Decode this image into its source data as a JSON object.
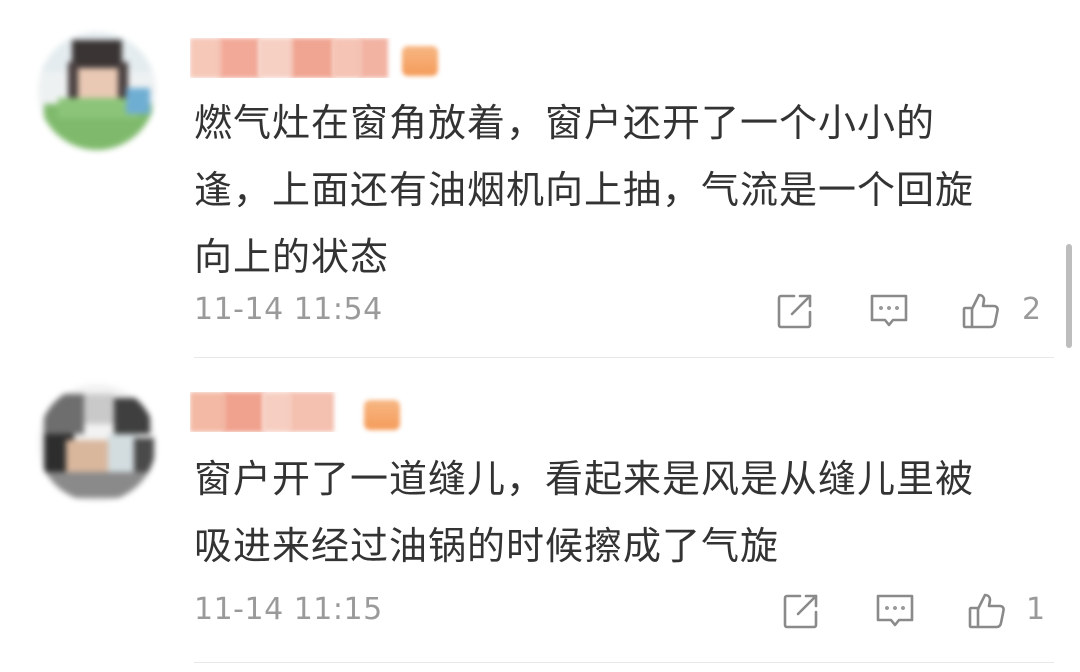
{
  "comments": [
    {
      "username": "",
      "text_lines": [
        "燃气灶在窗角放着，窗户还开了一个小小的",
        "逢，上面还有油烟机向上抽，气流是一个回旋",
        "向上的状态"
      ],
      "time": "11-14 11:54",
      "likes": "2"
    },
    {
      "username": "",
      "text_lines": [
        "窗户开了一道缝儿，看起来是风是从缝儿里被",
        "吸进来经过油锅的时候擦成了气旋"
      ],
      "time": "11-14 11:15",
      "likes": "1"
    }
  ],
  "icons": {
    "share": "share-icon",
    "comment": "comment-icon",
    "like": "thumbs-up-icon"
  },
  "colors": {
    "text": "#333333",
    "meta": "#9a9a9a",
    "divider": "#e8e8e8",
    "badge": "#f59c5b"
  }
}
